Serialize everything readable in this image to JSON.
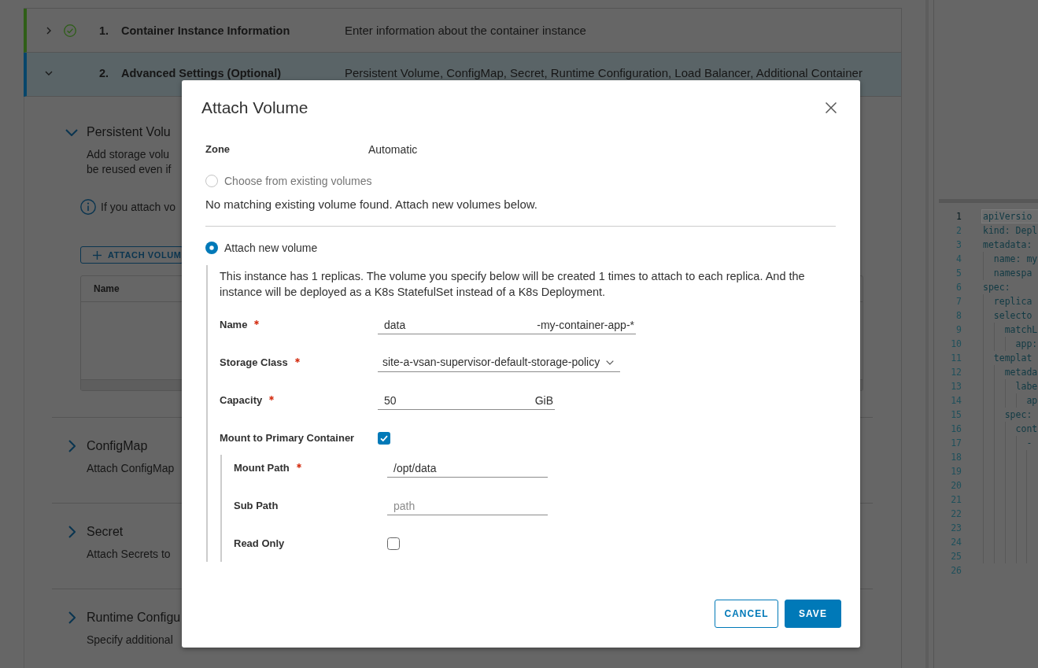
{
  "steps": [
    {
      "number": "1.",
      "title": "Container Instance Information",
      "description": "Enter information about the container instance",
      "complete": true,
      "selected": false,
      "expanded": false
    },
    {
      "number": "2.",
      "title": "Advanced Settings (Optional)",
      "description": "Persistent Volume, ConfigMap, Secret, Runtime Configuration, Load Balancer, Additional Container",
      "complete": false,
      "selected": true,
      "expanded": true
    }
  ],
  "sections": [
    {
      "title": "Persistent Volu",
      "expanded": true,
      "description_lines": [
        "Add storage volu",
        "be reused even if"
      ],
      "info": "If you attach vo",
      "button": "ATTACH VOLUM",
      "table": {
        "columns": [
          "Name"
        ]
      }
    },
    {
      "title": "ConfigMap",
      "expanded": false,
      "description_lines": [
        "Attach ConfigMap"
      ]
    },
    {
      "title": "Secret",
      "expanded": false,
      "description_lines": [
        "Attach Secrets to"
      ]
    },
    {
      "title": "Runtime Configu",
      "expanded": false,
      "description_lines": [
        "Specify additional"
      ]
    }
  ],
  "editor": {
    "lines": [
      {
        "number": "1",
        "text": "apiVersio",
        "active": true
      },
      {
        "number": "2",
        "text": "kind: Depl",
        "active": false
      },
      {
        "number": "3",
        "text": "metadata:",
        "active": false
      },
      {
        "number": "4",
        "text": "  name: my",
        "active": false
      },
      {
        "number": "5",
        "text": "  namespa",
        "active": false
      },
      {
        "number": "6",
        "text": "spec:",
        "active": false
      },
      {
        "number": "7",
        "text": "  replica",
        "active": false
      },
      {
        "number": "8",
        "text": "  selecto",
        "active": false
      },
      {
        "number": "9",
        "text": "    matchL",
        "active": false
      },
      {
        "number": "10",
        "text": "      app:",
        "active": false
      },
      {
        "number": "11",
        "text": "  templat",
        "active": false
      },
      {
        "number": "12",
        "text": "    metada",
        "active": false
      },
      {
        "number": "13",
        "text": "      labe",
        "active": false
      },
      {
        "number": "14",
        "text": "        ap",
        "active": false
      },
      {
        "number": "15",
        "text": "    spec:",
        "active": false
      },
      {
        "number": "16",
        "text": "      cont",
        "active": false
      },
      {
        "number": "17",
        "text": "        -",
        "active": false
      },
      {
        "number": "18",
        "active": false
      },
      {
        "number": "19",
        "active": false
      },
      {
        "number": "20",
        "active": false
      },
      {
        "number": "21",
        "active": false
      },
      {
        "number": "22",
        "active": false
      },
      {
        "number": "23",
        "active": false
      },
      {
        "number": "24",
        "active": false
      },
      {
        "number": "25",
        "active": false
      },
      {
        "number": "26",
        "active": false
      }
    ]
  },
  "dialog": {
    "title": "Attach Volume",
    "zone": {
      "label": "Zone",
      "value": "Automatic"
    },
    "existing": {
      "option": {
        "label": "Choose from existing volumes",
        "selected": false,
        "disabled": true
      },
      "message": "No matching existing volume found. Attach new volumes below."
    },
    "new_volume": {
      "option": {
        "label": "Attach new volume",
        "selected": true,
        "disabled": false
      },
      "note": "This instance has 1 replicas. The volume you specify below will be created 1 times to attach to each replica. And the instance will be deployed as a K8s StatefulSet instead of a K8s Deployment.",
      "fields": [
        {
          "kind": "text",
          "label": "Name",
          "required": true,
          "value": "data",
          "suffix": "-my-container-app-*"
        },
        {
          "kind": "select",
          "label": "Storage Class",
          "required": true,
          "value": "site-a-vsan-supervisor-default-storage-policy"
        },
        {
          "kind": "text",
          "label": "Capacity",
          "required": true,
          "value": "50",
          "suffix": "GiB"
        },
        {
          "kind": "checkbox",
          "label": "Mount to Primary Container",
          "checked": true,
          "children": [
            {
              "kind": "text",
              "label": "Mount Path",
              "required": true,
              "value": "/opt/data"
            },
            {
              "kind": "text",
              "label": "Sub Path",
              "required": false,
              "placeholder": "path"
            },
            {
              "kind": "checkbox",
              "label": "Read Only",
              "checked": false
            }
          ]
        }
      ]
    },
    "buttons": [
      {
        "label": "CANCEL",
        "kind": "secondary"
      },
      {
        "label": "SAVE",
        "kind": "primary"
      }
    ]
  }
}
